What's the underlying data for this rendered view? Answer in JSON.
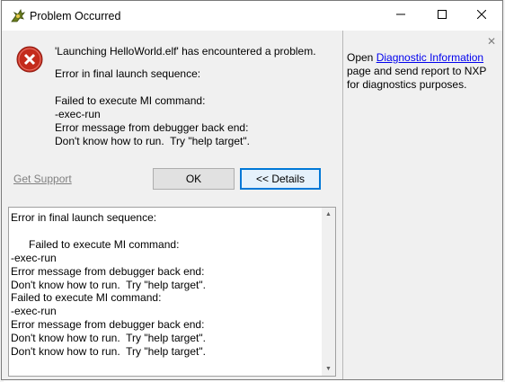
{
  "window": {
    "title": "Problem Occurred",
    "minimize_icon": "minimize-icon",
    "maximize_icon": "maximize-icon",
    "close_icon": "close-icon"
  },
  "message": {
    "icon": "error-icon",
    "headline": "'Launching HelloWorld.elf' has encountered a problem.",
    "subline": "Error in final launch sequence:",
    "details_lines": [
      "Failed to execute MI command:",
      "-exec-run",
      "Error message from debugger back end:",
      "Don't know how to run.  Try \"help target\"."
    ]
  },
  "actions": {
    "get_support": "Get Support",
    "ok": "OK",
    "details": "<< Details"
  },
  "details_box": {
    "text": "Error in final launch sequence:\n\n      Failed to execute MI command:\n-exec-run\nError message from debugger back end:\nDon't know how to run.  Try \"help target\".\nFailed to execute MI command:\n-exec-run\nError message from debugger back end:\nDon't know how to run.  Try \"help target\".\nDon't know how to run.  Try \"help target\"."
  },
  "right_panel": {
    "close_glyph": "✕",
    "text_before": "Open ",
    "link": "Diagnostic Information",
    "text_after": " page and send report to NXP for diagnostics purposes."
  },
  "colors": {
    "accent": "#0078d7",
    "error_red": "#c42b1c",
    "link": "#0000ee"
  }
}
